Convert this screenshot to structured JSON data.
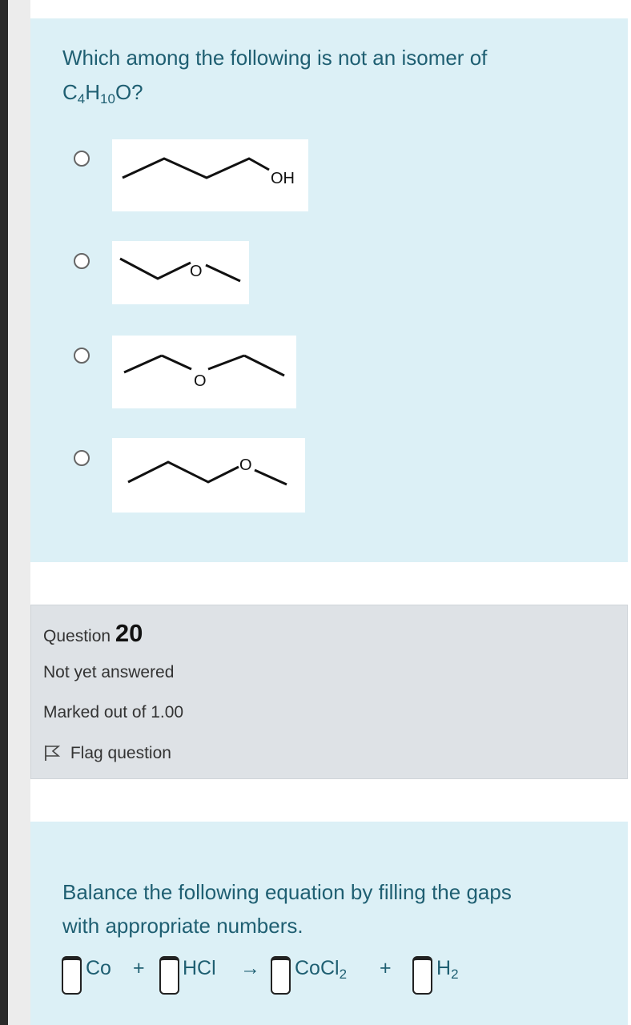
{
  "question19": {
    "text_line1": "Which among the following is not an isomer of",
    "formula": {
      "c": "C",
      "c_sub": "4",
      "h": "H",
      "h_sub": "10",
      "o": "O?"
    },
    "options": [
      {
        "label": "OH"
      },
      {
        "label": "O"
      },
      {
        "label": "O"
      },
      {
        "label": "O"
      }
    ]
  },
  "question20": {
    "heading_prefix": "Question ",
    "number": "20",
    "status": "Not yet answered",
    "marks": "Marked out of 1.00",
    "flag_label": "Flag question",
    "text_line1": "Balance the following equation by filling the gaps",
    "text_line2": "with appropriate numbers.",
    "equation": {
      "t1": "Co",
      "plus1": "+",
      "t2": "HCl",
      "arrow": "→",
      "t3": "CoCl",
      "t3_sub": "2",
      "plus2": "+",
      "t4": "H",
      "t4_sub": "2"
    }
  },
  "colors": {
    "panel": "#dcf0f6",
    "info_panel": "#dee2e6",
    "question_text": "#1f5f72"
  },
  "icons": [
    "radio-icon",
    "flag-icon"
  ]
}
